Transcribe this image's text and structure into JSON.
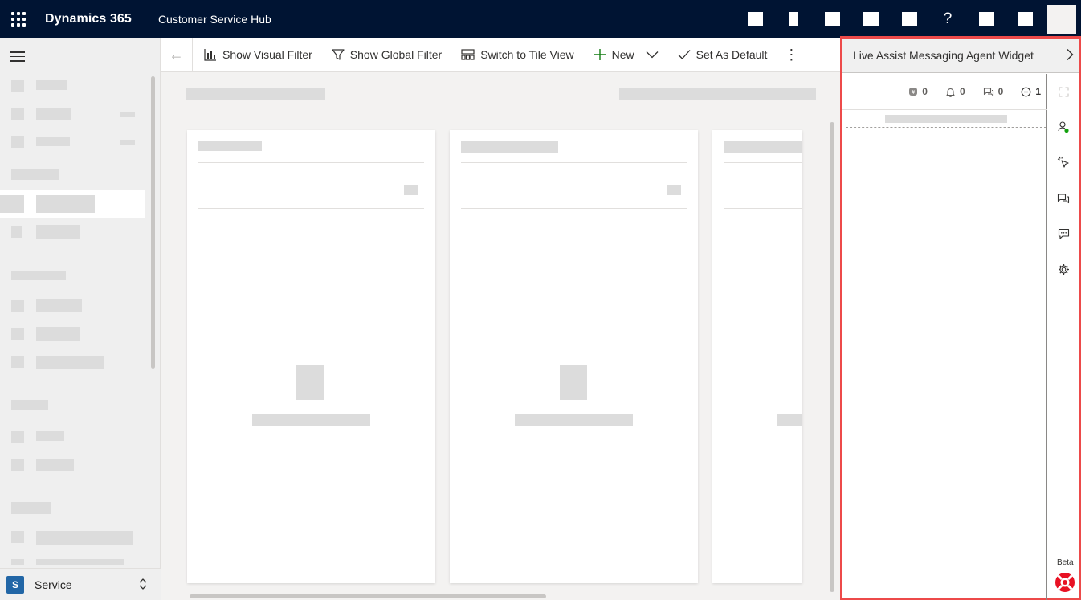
{
  "topbar": {
    "brand": "Dynamics 365",
    "app_name": "Customer Service Hub",
    "help_glyph": "?"
  },
  "nav": {
    "area_badge": "S",
    "area_label": "Service"
  },
  "commandbar": {
    "back_glyph": "←",
    "items": [
      {
        "label": "Show Visual Filter",
        "icon": "chart-icon"
      },
      {
        "label": "Show Global Filter",
        "icon": "filter-icon"
      },
      {
        "label": "Switch to Tile View",
        "icon": "tile-view-icon"
      },
      {
        "label": "New",
        "icon": "plus-icon"
      },
      {
        "label": "Set As Default",
        "icon": "checkmark-icon"
      }
    ],
    "more_glyph": "⋮"
  },
  "widget": {
    "title": "Live Assist Messaging Agent Widget",
    "collapse_glyph": ">",
    "stats": [
      {
        "icon": "badge-icon",
        "value": "0"
      },
      {
        "icon": "bell-icon",
        "value": "0"
      },
      {
        "icon": "chats-icon",
        "value": "0"
      },
      {
        "icon": "minus-circle-icon",
        "value": "1"
      }
    ],
    "beta_label": "Beta",
    "status_color": "#13a10e",
    "accent_color": "#ed4a4a"
  }
}
